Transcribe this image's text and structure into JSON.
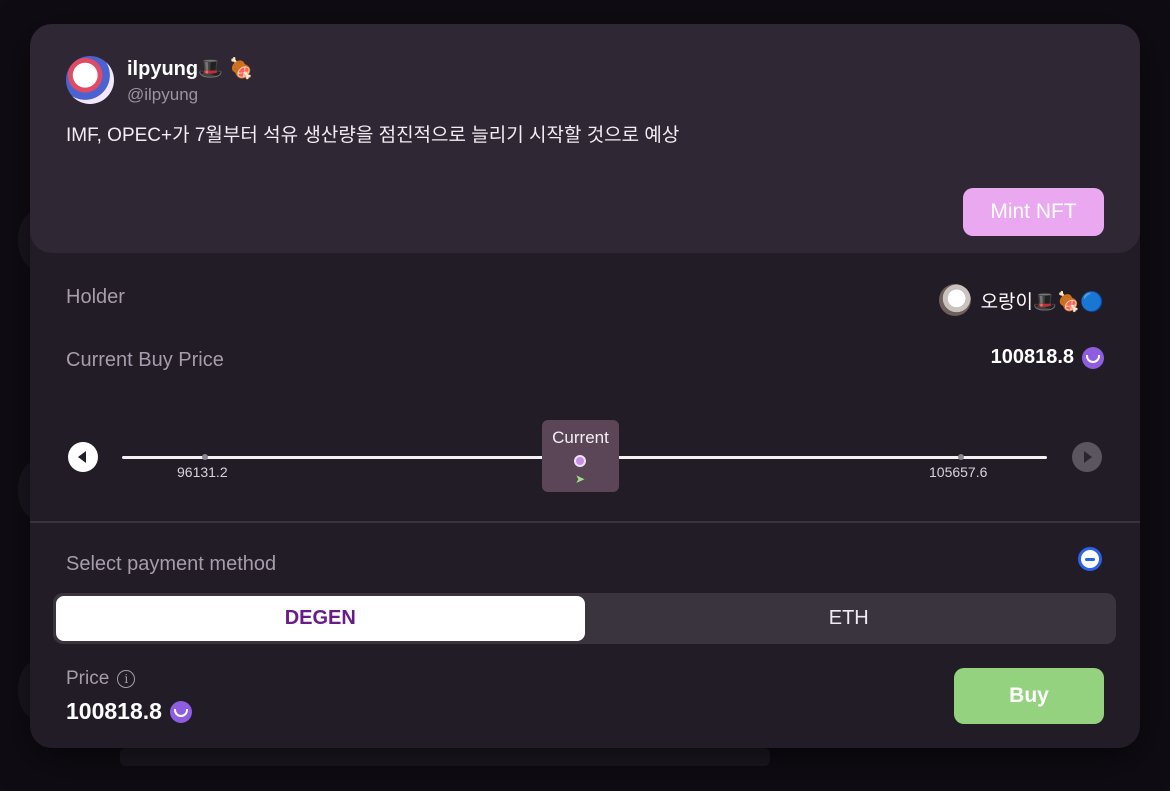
{
  "cast": {
    "display_name": "ilpyung🎩 🍖",
    "handle": "@ilpyung",
    "text": "IMF, OPEC+가 7월부터 석유 생산량을 점진적으로 늘리기 시작할 것으로 예상",
    "mint_label": "Mint NFT"
  },
  "holder": {
    "label": "Holder",
    "name": "오랑이🎩🍖🔵"
  },
  "buy_price": {
    "label": "Current Buy Price",
    "value": "100818.8"
  },
  "slider": {
    "left_tick": "96131.2",
    "right_tick": "105657.6",
    "current_label": "Current"
  },
  "payment": {
    "label": "Select payment method",
    "options": [
      "DEGEN",
      "ETH"
    ],
    "selected": "DEGEN"
  },
  "price": {
    "label": "Price",
    "value": "100818.8"
  },
  "buy_label": "Buy",
  "colors": {
    "mint": "#e9a8ef",
    "buy": "#94d27f",
    "degen": "#8f5de0",
    "selected_text": "#6a1c86"
  }
}
